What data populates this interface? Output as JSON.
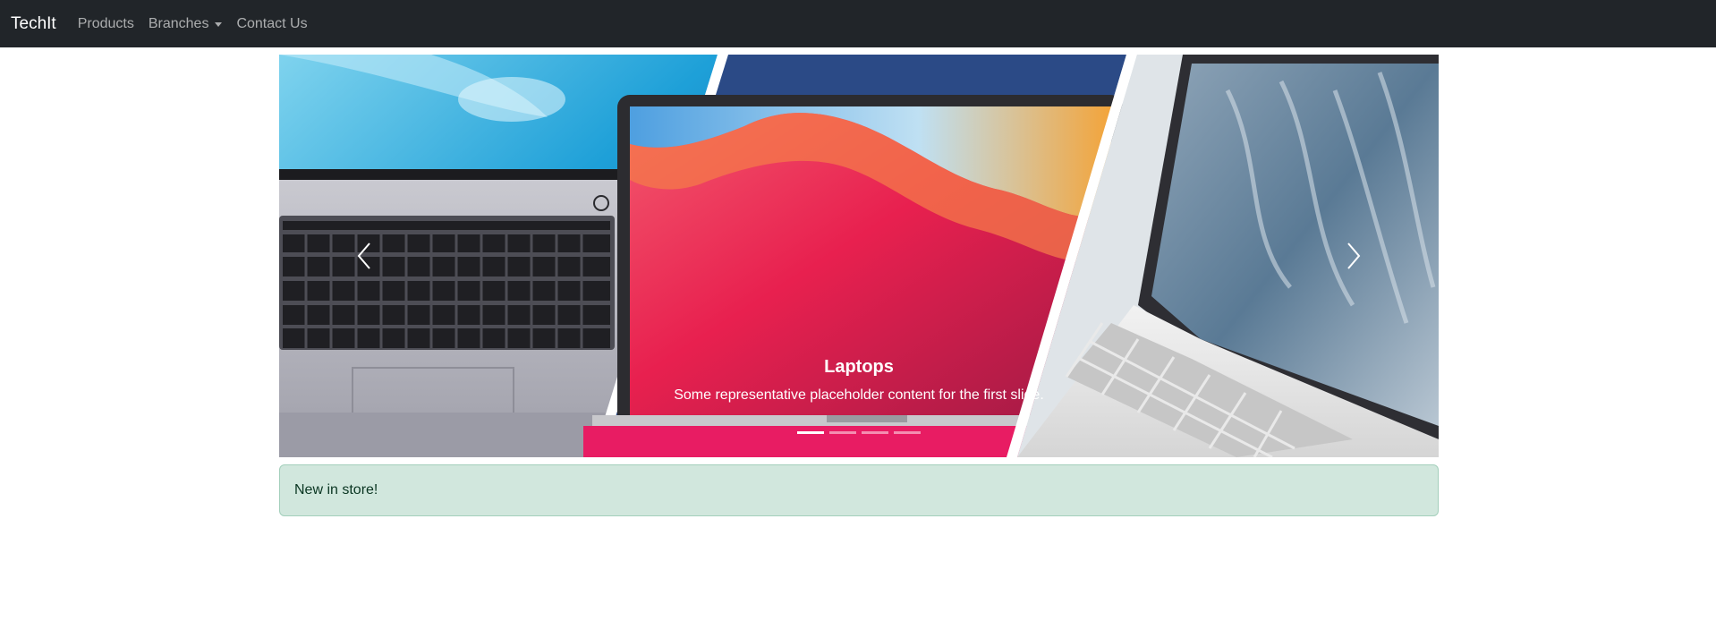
{
  "navbar": {
    "brand": "TechIt",
    "links": [
      {
        "label": "Products"
      },
      {
        "label": "Branches"
      },
      {
        "label": "Contact Us"
      }
    ]
  },
  "carousel": {
    "caption_title": "Laptops",
    "caption_text": "Some representative placeholder content for the first slide.",
    "active_slide": 1,
    "slide_count": 4,
    "prev_icon": "chevron-left-icon",
    "next_icon": "chevron-right-icon"
  },
  "alert": {
    "text": "New in store!",
    "color": "#d1e7dd"
  },
  "colors": {
    "navbar_bg": "#212529",
    "alert_bg": "#d1e7dd",
    "alert_border": "#a3cfbb"
  }
}
